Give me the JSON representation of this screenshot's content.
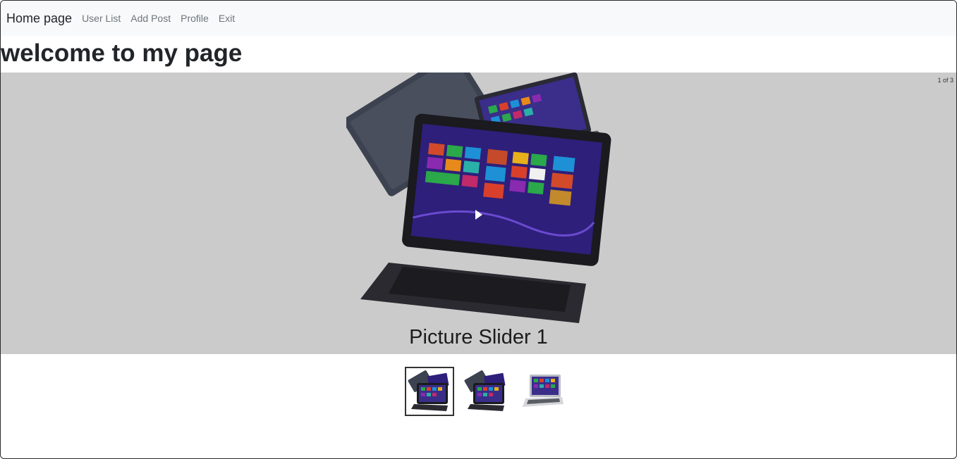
{
  "navbar": {
    "brand": "Home page",
    "links": [
      "User List",
      "Add Post",
      "Profile",
      "Exit"
    ]
  },
  "page": {
    "title": "welcome to my page"
  },
  "carousel": {
    "counter": "1 of 3",
    "caption": "Picture Slider 1",
    "background": "#cbcbcb",
    "active_index": 1,
    "thumbnail_count": 3,
    "play_icon": "play-icon"
  },
  "colors": {
    "navbar_bg": "#f8f9fa",
    "link": "#6c757d",
    "text": "#212529"
  }
}
